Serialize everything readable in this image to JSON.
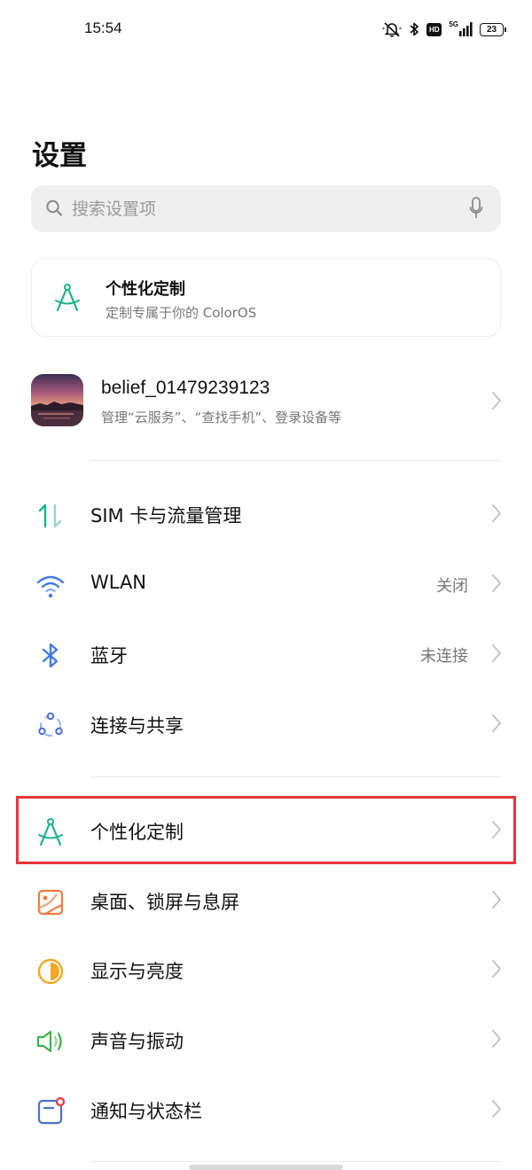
{
  "status_bar": {
    "time": "15:54",
    "hd": "HD",
    "network": "5G",
    "battery": "23",
    "icons": [
      "mute-icon",
      "bluetooth-icon",
      "hd-icon",
      "signal-icon",
      "battery-icon"
    ]
  },
  "page": {
    "title": "设置"
  },
  "search": {
    "placeholder": "搜索设置项"
  },
  "promo": {
    "title": "个性化定制",
    "subtitle": "定制专属于你的 ColorOS",
    "icon": "compass-icon"
  },
  "account": {
    "name": "belief_01479239123",
    "subtitle": "管理“云服务”、“查找手机”、登录设备等"
  },
  "settings": [
    {
      "label": "SIM 卡与流量管理",
      "value": "",
      "icon": "sim-data-icon",
      "color": "#1bb38a"
    },
    {
      "label": "WLAN",
      "value": "关闭",
      "icon": "wifi-icon",
      "color": "#3f7be8"
    },
    {
      "label": "蓝牙",
      "value": "未连接",
      "icon": "bluetooth-icon",
      "color": "#3f7be8"
    },
    {
      "label": "连接与共享",
      "value": "",
      "icon": "share-connect-icon",
      "color": "#4a6fd8"
    },
    {
      "label": "个性化定制",
      "value": "",
      "icon": "compass-icon",
      "color": "#1bb38a",
      "highlighted": true
    },
    {
      "label": "桌面、锁屏与息屏",
      "value": "",
      "icon": "wallpaper-icon",
      "color": "#f07a3c"
    },
    {
      "label": "显示与亮度",
      "value": "",
      "icon": "brightness-icon",
      "color": "#f5a623"
    },
    {
      "label": "声音与振动",
      "value": "",
      "icon": "speaker-icon",
      "color": "#3ab54a"
    },
    {
      "label": "通知与状态栏",
      "value": "",
      "icon": "notification-icon",
      "color": "#4a6fd8"
    }
  ],
  "highlight_color": "#e8363a"
}
